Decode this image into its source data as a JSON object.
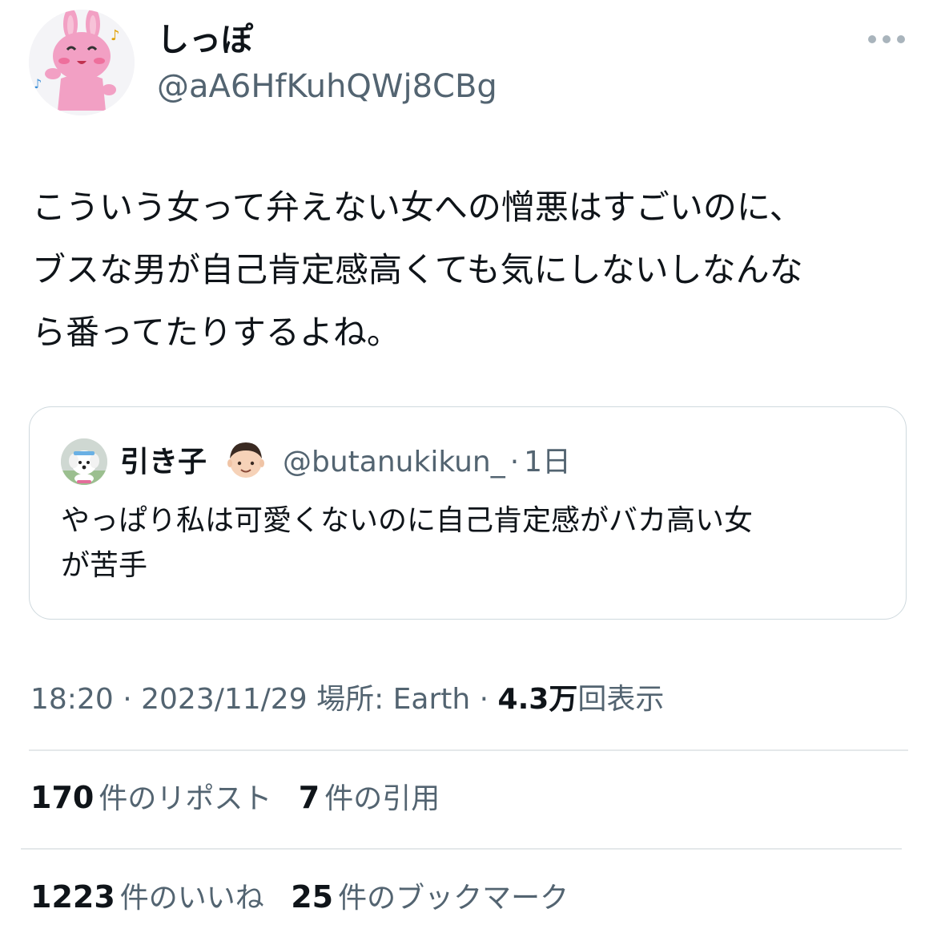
{
  "author": {
    "display_name": "しっぽ",
    "handle": "@aA6HfKuhQWj8CBg"
  },
  "tweet": {
    "lines": [
      "こういう女って弁えない女への憎悪はすごいのに、",
      "ブスな男が自己肯定感高くても気にしないしなんな",
      "ら番ってたりするよね。"
    ]
  },
  "quote": {
    "display_name": "引き子",
    "handle": "@butanukikun_",
    "separator": "·",
    "time": "1日",
    "lines": [
      "やっぱり私は可愛くないのに自己肯定感がバカ高い女",
      "が苦手"
    ]
  },
  "meta": {
    "time": "18:20",
    "sep1": "·",
    "date": "2023/11/29",
    "location": "場所: Earth",
    "sep2": "·",
    "views_count": "4.3万",
    "views_label": "回表示"
  },
  "stats": {
    "reposts_count": "170",
    "reposts_label": "件のリポスト",
    "quotes_count": "7",
    "quotes_label": "件の引用",
    "likes_count": "1223",
    "likes_label": "件のいいね",
    "bookmarks_count": "25",
    "bookmarks_label": "件のブックマーク"
  },
  "icons": {
    "avatar": "pink-rabbit-avatar",
    "quote_avatar": "white-dog-avatar",
    "name_emoji": "boy-emoji",
    "more": "more-dots-icon"
  },
  "colors": {
    "text": "#0f1419",
    "secondary": "#536471",
    "border": "#cfd9de",
    "divider": "#e4e8ea",
    "avatar_pink": "#f2a0c4"
  }
}
